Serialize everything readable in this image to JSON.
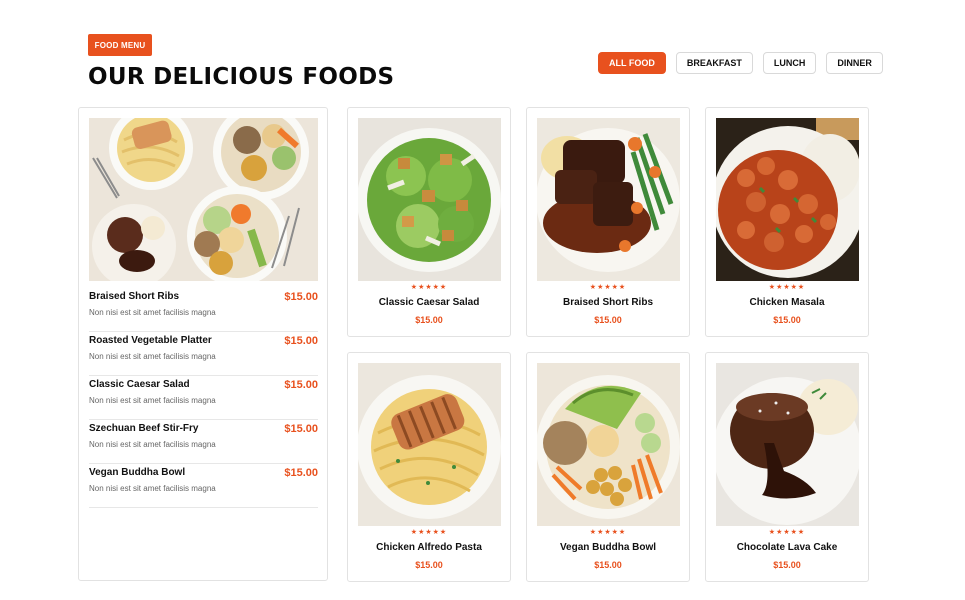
{
  "header": {
    "badge": "FOOD MENU",
    "title": "OUR DELICIOUS FOODS"
  },
  "filters": [
    {
      "label": "ALL FOOD",
      "active": true
    },
    {
      "label": "BREAKFAST",
      "active": false
    },
    {
      "label": "LUNCH",
      "active": false
    },
    {
      "label": "DINNER",
      "active": false
    }
  ],
  "menu_list": [
    {
      "name": "Braised Short Ribs",
      "price": "$15.00",
      "desc": "Non nisi est sit amet facilisis magna"
    },
    {
      "name": "Roasted Vegetable Platter",
      "price": "$15.00",
      "desc": "Non nisi est sit amet facilisis magna"
    },
    {
      "name": "Classic Caesar Salad",
      "price": "$15.00",
      "desc": "Non nisi est sit amet facilisis magna"
    },
    {
      "name": "Szechuan Beef Stir-Fry",
      "price": "$15.00",
      "desc": "Non nisi est sit amet facilisis magna"
    },
    {
      "name": "Vegan Buddha Bowl",
      "price": "$15.00",
      "desc": "Non nisi est sit amet facilisis magna"
    }
  ],
  "cards": [
    {
      "name": "Classic Caesar Salad",
      "price": "$15.00",
      "stars": "★★★★★"
    },
    {
      "name": "Braised Short Ribs",
      "price": "$15.00",
      "stars": "★★★★★"
    },
    {
      "name": "Chicken Masala",
      "price": "$15.00",
      "stars": "★★★★★"
    },
    {
      "name": "Chicken Alfredo Pasta",
      "price": "$15.00",
      "stars": "★★★★★"
    },
    {
      "name": "Vegan Buddha Bowl",
      "price": "$15.00",
      "stars": "★★★★★"
    },
    {
      "name": "Chocolate Lava Cake",
      "price": "$15.00",
      "stars": "★★★★★"
    }
  ],
  "colors": {
    "accent": "#e8511e"
  }
}
